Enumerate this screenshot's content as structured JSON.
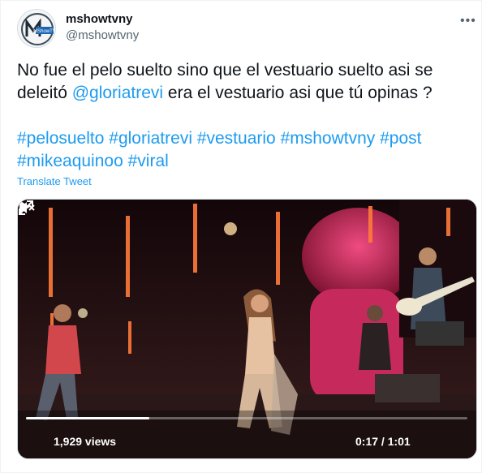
{
  "account": {
    "name": "mshowtvny",
    "handle": "@mshowtvny",
    "avatar_text": "MShowTV"
  },
  "tweet": {
    "line1": "No fue el pelo suelto sino que el vestuario suelto asi se",
    "line2_start": "deleitó ",
    "mention": "@gloriatrevi",
    "line2_end": " era el vestuario asi que tú opinas ?",
    "hashtags": [
      "#pelosuelto",
      "#gloriatrevi",
      "#vestuario",
      "#mshowtvny",
      "#post",
      "#mikeaquinoo",
      "#viral"
    ],
    "translate_label": "Translate Tweet"
  },
  "video": {
    "views": "1,929 views",
    "time": "0:17 / 1:01",
    "progress": 0.279
  },
  "colors": {
    "link": "#1d9bf0",
    "secondary": "#536471",
    "stage_pink": "#e0336a"
  }
}
